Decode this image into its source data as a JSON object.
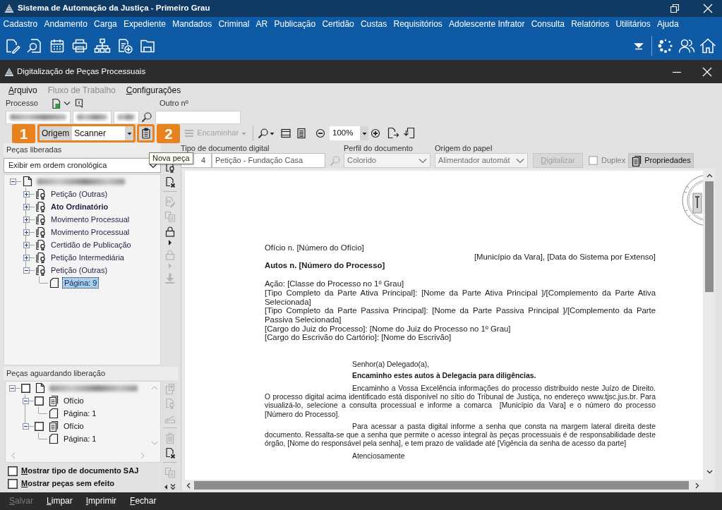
{
  "app": {
    "title": "Sistema de Automação da Justiça - Primeiro Grau"
  },
  "main_menu": [
    "Cadastro",
    "Andamento",
    "Carga",
    "Expediente",
    "Mandados",
    "Criminal",
    "AR",
    "Publicação",
    "Certidão",
    "Custas",
    "Requisitórios",
    "Adolescente Infrator",
    "Consulta",
    "Relatórios",
    "Utilitários",
    "Ajuda"
  ],
  "dialog": {
    "title": "Digitalização de Peças Processuais"
  },
  "dialog_menu": [
    {
      "label": "Arquivo",
      "disabled": false
    },
    {
      "label": "Fluxo de Trabalho",
      "disabled": true
    },
    {
      "label": "Configurações",
      "disabled": false
    }
  ],
  "process": {
    "label": "Processo",
    "fields": [
      {
        "redacted": true
      },
      {
        "redacted": true
      },
      {
        "redacted": true
      }
    ]
  },
  "other_number": {
    "label": "Outro nº"
  },
  "toolbar": {
    "callouts": [
      "1",
      "2"
    ],
    "origin": {
      "label": "Origem",
      "value": "Scanner",
      "highlighted": true
    },
    "new_piece": {
      "highlighted": true
    },
    "forward": {
      "label": "Encaminhar",
      "disabled": true
    },
    "zoom": {
      "value": "100%"
    }
  },
  "tooltip": "Nova peça",
  "released": {
    "title": "Peças liberadas",
    "order": "Exibir em ordem cronológica",
    "tools": [
      {
        "kind": "seal",
        "disabled": false
      },
      {
        "kind": "remove",
        "disabled": false
      },
      {
        "kind": "separator"
      },
      {
        "kind": "rename",
        "disabled": true
      },
      {
        "kind": "copy",
        "disabled": true
      },
      {
        "kind": "lock",
        "disabled": false
      },
      {
        "kind": "arrow",
        "disabled": false
      },
      {
        "kind": "lock",
        "disabled": true
      },
      {
        "kind": "arrow",
        "disabled": true
      },
      {
        "kind": "download",
        "disabled": true
      }
    ],
    "tree": [
      {
        "kind": "process",
        "redacted": true,
        "expanded": true,
        "selected": false,
        "children": [
          {
            "kind": "piece",
            "label": "Petição (Outras)",
            "signed": true,
            "expanded": false,
            "bold": false,
            "selected": false
          },
          {
            "kind": "piece",
            "label": "Ato Ordinatório",
            "signed": true,
            "expanded": false,
            "bold": true,
            "selected": false
          },
          {
            "kind": "piece",
            "label": "Movimento Processual",
            "signed": true,
            "expanded": false,
            "bold": false,
            "selected": false
          },
          {
            "kind": "piece",
            "label": "Movimento Processual",
            "signed": true,
            "expanded": false,
            "bold": false,
            "selected": false
          },
          {
            "kind": "piece",
            "label": "Certidão de Publicação",
            "signed": true,
            "expanded": false,
            "bold": false,
            "selected": false
          },
          {
            "kind": "piece",
            "label": "Petição Intermediária",
            "signed": true,
            "expanded": false,
            "bold": false,
            "selected": false
          },
          {
            "kind": "piece",
            "label": "Petição (Outras)",
            "signed": true,
            "expanded": true,
            "bold": false,
            "selected": false,
            "children": [
              {
                "kind": "page",
                "label": "Página: 9",
                "bold": false,
                "selected": true
              }
            ]
          }
        ]
      }
    ]
  },
  "document_fields": {
    "type": {
      "label": "Tipo de documento digital",
      "code": "4",
      "value": "Petição - Fundação Casa"
    },
    "profile": {
      "label": "Perfil do documento",
      "value": "Colorido",
      "disabled": true
    },
    "paper_source": {
      "label": "Origem do papel",
      "value": "Alimentador automát",
      "disabled": true
    },
    "scan_button": {
      "label": "Digitalizar",
      "disabled": true
    },
    "duplex": {
      "label": "Duplex",
      "checked": false,
      "disabled": true
    },
    "properties": {
      "label": "Propriedades"
    }
  },
  "pending": {
    "title": "Peças aguardando liberação",
    "tools": [
      {
        "kind": "export",
        "disabled": true
      },
      {
        "kind": "seal",
        "disabled": true
      },
      {
        "kind": "scanner",
        "disabled": true
      },
      {
        "kind": "separator"
      },
      {
        "kind": "trash",
        "disabled": true
      },
      {
        "kind": "remove",
        "disabled": false
      },
      {
        "kind": "separator"
      },
      {
        "kind": "copy",
        "disabled": true
      }
    ],
    "tree": [
      {
        "kind": "process",
        "redacted": true,
        "checked": false,
        "expanded": true,
        "selected": false,
        "children": [
          {
            "kind": "piece",
            "label": "Ofício",
            "signed": false,
            "checked": false,
            "expanded": true,
            "selected": false,
            "children": [
              {
                "kind": "page",
                "label": "Página: 1",
                "selected": false
              }
            ]
          },
          {
            "kind": "piece",
            "label": "Ofício",
            "signed": false,
            "checked": false,
            "expanded": true,
            "selected": false,
            "children": [
              {
                "kind": "page",
                "label": "Página: 1",
                "selected": false
              }
            ]
          }
        ]
      }
    ]
  },
  "options": [
    {
      "label": "Mostrar tipo de documento SAJ",
      "checked": false
    },
    {
      "label": "Mostrar peças sem efeito",
      "checked": false
    }
  ],
  "document": {
    "blocks": [
      {
        "kind": "line",
        "text": "Ofício n. [Número do Ofício]"
      },
      {
        "kind": "right",
        "text": "[Município da Vara], [Data do Sistema por Extenso]"
      },
      {
        "kind": "title",
        "text": "Autos n. [Número do Processo]"
      },
      {
        "kind": "line",
        "text": "Ação: [Classe do Processo no 1º Grau]"
      },
      {
        "kind": "justify",
        "text": "[Tipo Completo da Parte Ativa Principal]: [Nome da Parte Ativa Principal ]/[Complemento da Parte Ativa Selecionada]"
      },
      {
        "kind": "justify",
        "text": "[Tipo Completo da Parte Passiva Principal]: [Nome da Parte Passiva Principal ]/[Complemento da Parte Passiva Selecionada]"
      },
      {
        "kind": "line",
        "text": "[Cargo do Juiz do Processo]: [Nome do Juiz do Processo no 1º Grau]"
      },
      {
        "kind": "line",
        "text": "[Cargo do Escrivão do Cartório]: [Nome do Escrivão]"
      },
      {
        "kind": "greeting",
        "text": "Senhor(a) Delegado(a),"
      },
      {
        "kind": "lead",
        "text": "Encaminho estes autos à Delegacia para diligências."
      },
      {
        "kind": "paragraph",
        "text": "Encaminho a Vossa Excelência informações do processo distribuído neste Juízo de Direito. O processo digital acima identificado está disponível no sítio do Tribunal de Justiça, no endereço www.tjsc.jus.br. Para visualizá-lo, selecione a consulta processual e informe a comarca  [Município da Vara] e o número do processo [Número do Processo]."
      },
      {
        "kind": "paragraph",
        "text": "Para acessar a pasta digital informe a senha que consta na margem lateral direita deste documento. Ressalta-se que a senha que permite o acesso integral às peças processuais é de responsabilidade deste órgão, [Nome do responsável pela senha], e tem prazo de validade até [Vigência da senha de acesso da parte]"
      },
      {
        "kind": "closing",
        "text": "Atenciosamente"
      }
    ]
  },
  "footer": [
    {
      "label": "Salvar",
      "disabled": true
    },
    {
      "label": "Limpar",
      "disabled": false
    },
    {
      "label": "Imprimir",
      "disabled": false
    },
    {
      "label": "Fechar",
      "disabled": false
    }
  ]
}
